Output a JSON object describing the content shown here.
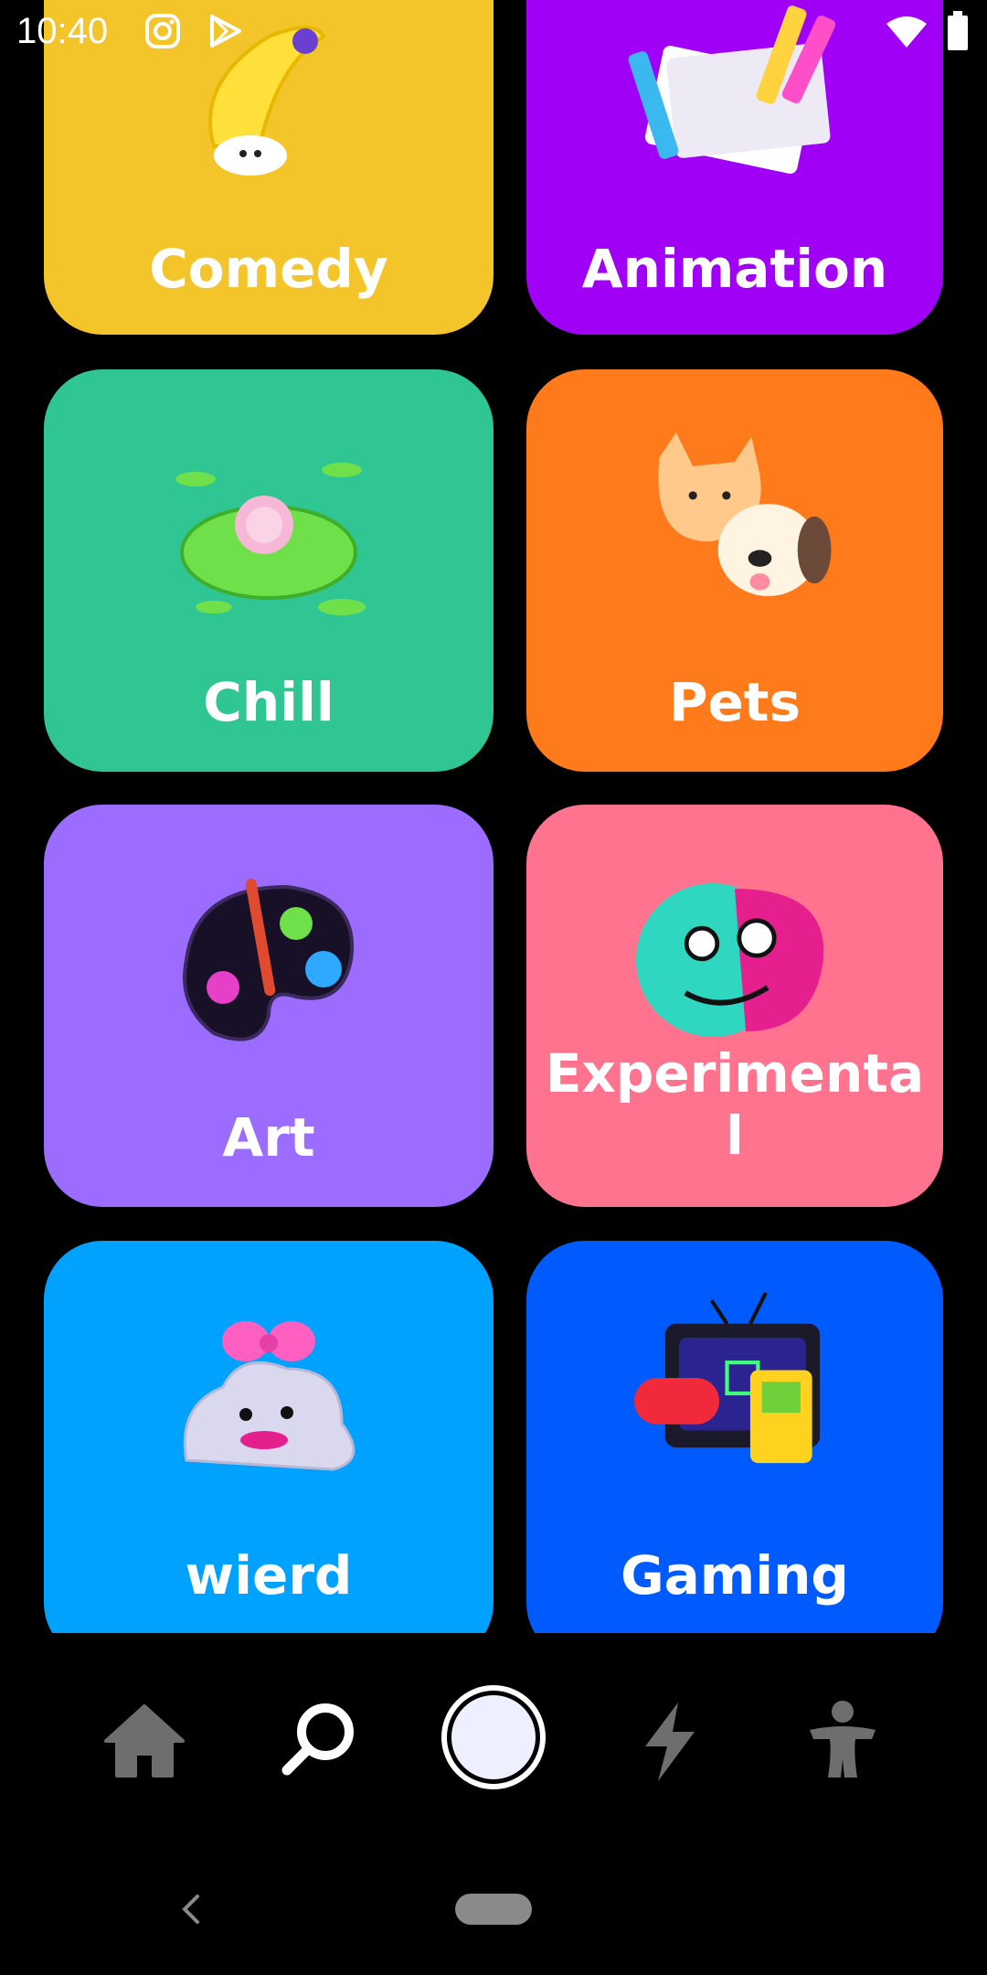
{
  "status_bar": {
    "time": "10:40",
    "icons": [
      "instagram-icon",
      "play-store-icon",
      "wifi-icon",
      "battery-icon"
    ]
  },
  "categories": [
    {
      "label": "Comedy",
      "color": "#F3C52B",
      "icon": "banana-icon"
    },
    {
      "label": "Animation",
      "color": "#A100F7",
      "icon": "sketchbook-pencils-icon"
    },
    {
      "label": "Chill",
      "color": "#2FC693",
      "icon": "lily-pad-icon"
    },
    {
      "label": "Pets",
      "color": "#FF7A1A",
      "icon": "cat-dog-icon"
    },
    {
      "label": "Art",
      "color": "#9B6CFF",
      "icon": "paint-palette-icon"
    },
    {
      "label": "Experimental",
      "color": "#FF738F",
      "icon": "abstract-face-icon"
    },
    {
      "label": "wierd",
      "color": "#00A2FF",
      "icon": "slime-bow-icon"
    },
    {
      "label": "Gaming",
      "color": "#005BFF",
      "icon": "tv-game-controller-icon"
    }
  ],
  "bottom_nav": {
    "items": [
      "home-icon",
      "search-icon",
      "record-button",
      "lightning-icon",
      "profile-icon"
    ],
    "active": "search-icon"
  },
  "system_nav": [
    "back-icon",
    "home-pill"
  ]
}
